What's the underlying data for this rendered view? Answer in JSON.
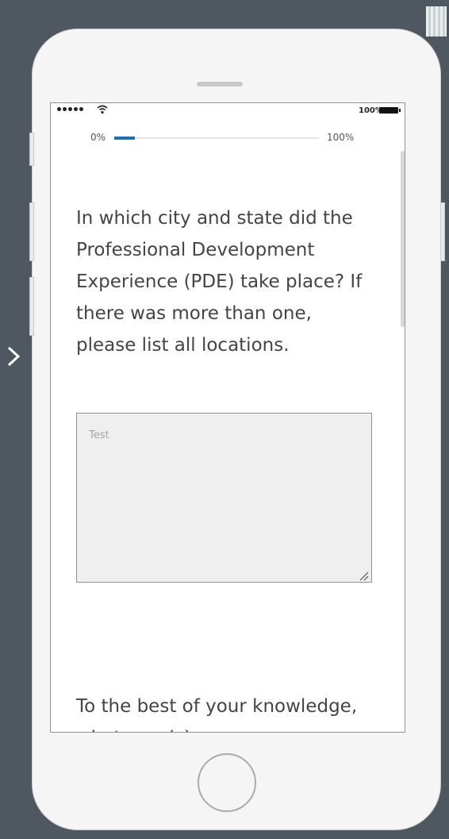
{
  "status_bar": {
    "signal_icon": "signal-dots-icon",
    "wifi_icon": "wifi-icon",
    "battery_text": "100%",
    "battery_icon": "battery-icon"
  },
  "progress": {
    "min_label": "0%",
    "max_label": "100%",
    "value_percent": 10,
    "fill_color": "#1a6fb5"
  },
  "survey": {
    "question_1": "In which city and state did the Professional Development Experience (PDE) take place? If there was more than one, please list all locations.",
    "answer_1": {
      "value": "",
      "placeholder": "Test"
    },
    "question_2": "To the best of your knowledge, what year(s)"
  },
  "icons": {
    "nav_arrow": "chevron-right-icon",
    "qr": "qr-code-icon",
    "home": "home-button-icon"
  },
  "colors": {
    "background": "#4f5860",
    "phone_body": "#f5f5f5",
    "text": "#444444",
    "input_bg": "#efefef"
  }
}
